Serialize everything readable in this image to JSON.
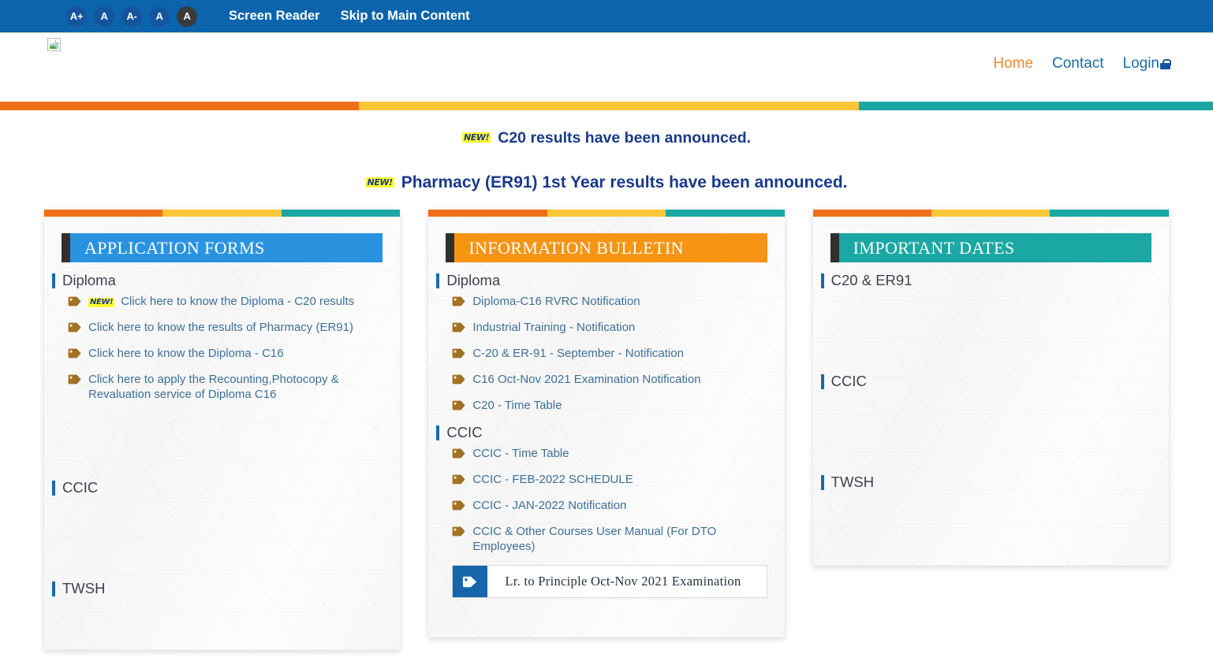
{
  "topbar": {
    "accessibility_buttons": [
      {
        "label": "A+",
        "name": "font-increase-button",
        "style": "blue"
      },
      {
        "label": "A",
        "name": "font-normal-button",
        "style": "blue"
      },
      {
        "label": "A-",
        "name": "font-decrease-button",
        "style": "blue"
      },
      {
        "label": "A",
        "name": "contrast-normal-button",
        "style": "blue"
      },
      {
        "label": "A",
        "name": "contrast-high-button",
        "style": "dark"
      }
    ],
    "links": [
      {
        "label": "Screen Reader",
        "name": "screen-reader-link"
      },
      {
        "label": "Skip to Main Content",
        "name": "skip-to-main-content-link"
      }
    ],
    "background_color": "#0b64ac"
  },
  "header": {
    "logo_alt": "broken-image-icon",
    "nav": [
      {
        "label": "Home",
        "name": "nav-home",
        "active": true
      },
      {
        "label": "Contact",
        "name": "nav-contact",
        "active": false
      },
      {
        "label": "Login",
        "name": "nav-login",
        "active": false,
        "icon": "lock-icon"
      }
    ]
  },
  "stripe": {
    "colors": [
      "#f0701a",
      "#fcc636",
      "#1ba7a4"
    ]
  },
  "announcements": [
    {
      "badge": "NEW!",
      "text": "C20 results have been announced."
    },
    {
      "badge": "NEW!",
      "text": "Pharmacy (ER91) 1st Year results have been announced."
    }
  ],
  "cards": [
    {
      "title": "APPLICATION FORMS",
      "header_color": "#2a93e0",
      "sections": [
        {
          "label": "Diploma",
          "links": [
            {
              "badge": "NEW!",
              "text": "Click here to know the Diploma - C20 results"
            },
            {
              "badge": "",
              "text": "Click here to know the results of Pharmacy (ER91)"
            },
            {
              "badge": "",
              "text": "Click here to know the Diploma - C16"
            },
            {
              "badge": "",
              "text": "Click here to apply the Recounting,Photocopy & Revaluation service of Diploma C16"
            }
          ]
        },
        {
          "label": "CCIC",
          "links": []
        },
        {
          "label": "TWSH",
          "links": []
        }
      ]
    },
    {
      "title": "INFORMATION BULLETIN",
      "header_color": "#f79413",
      "sections": [
        {
          "label": "Diploma",
          "links": [
            {
              "badge": "",
              "text": "Diploma-C16 RVRC Notification"
            },
            {
              "badge": "",
              "text": "Industrial Training - Notification"
            },
            {
              "badge": "",
              "text": "C-20 & ER-91 - September - Notification"
            },
            {
              "badge": "",
              "text": "C16 Oct-Nov 2021 Examination Notification"
            },
            {
              "badge": "",
              "text": "C20 - Time Table"
            }
          ]
        },
        {
          "label": "CCIC",
          "links": [
            {
              "badge": "",
              "text": "CCIC - Time Table"
            },
            {
              "badge": "",
              "text": "CCIC - FEB-2022 SCHEDULE"
            },
            {
              "badge": "",
              "text": "CCIC - JAN-2022 Notification"
            },
            {
              "badge": "",
              "text": "CCIC & Other Courses User Manual (For DTO Employees)"
            }
          ]
        }
      ],
      "boxed_link": {
        "text": "Lr. to Principle Oct-Nov 2021 Examination",
        "tag_color": "#1565a8"
      }
    },
    {
      "title": "IMPORTANT DATES",
      "header_color": "#1ba7a4",
      "sections": [
        {
          "label": "C20 & ER91",
          "links": []
        },
        {
          "label": "CCIC",
          "links": []
        },
        {
          "label": "TWSH",
          "links": []
        }
      ]
    }
  ]
}
